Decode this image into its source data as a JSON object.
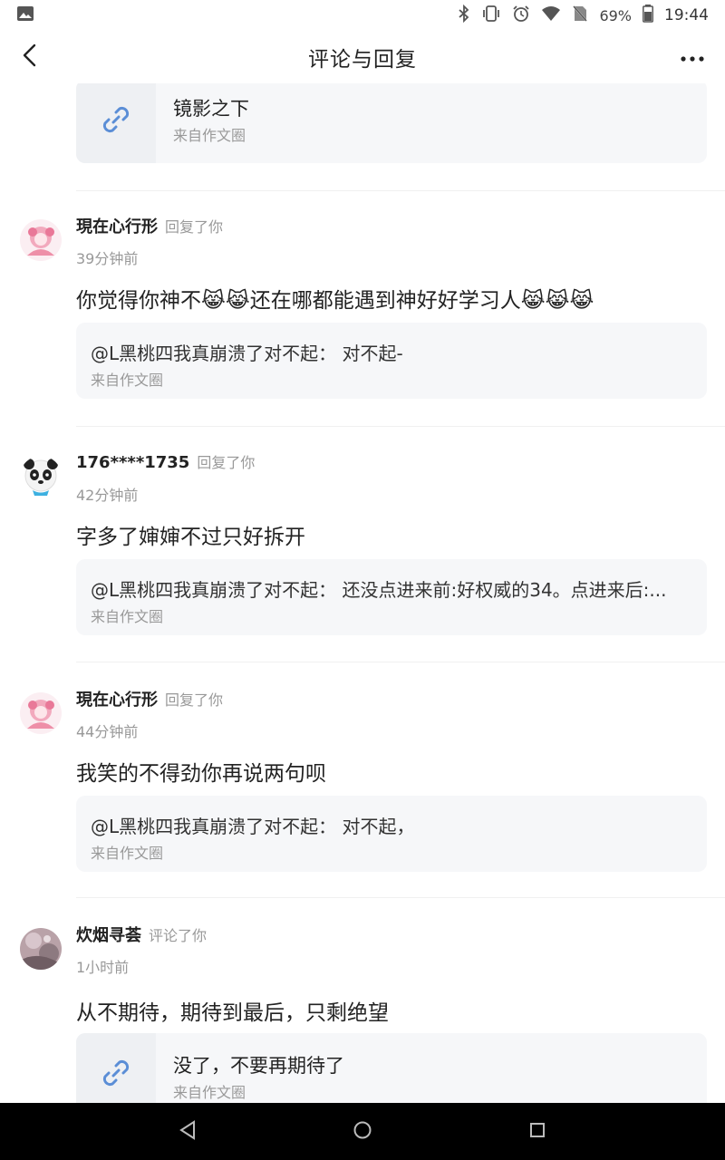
{
  "status_bar": {
    "battery": "69%",
    "time": "19:44",
    "icons": [
      "image-icon",
      "bluetooth-icon",
      "vibrate-icon",
      "alarm-icon",
      "wifi-icon",
      "no-sim-icon",
      "battery-icon"
    ]
  },
  "header": {
    "title": "评论与回复",
    "back_icon": "back-arrow-icon",
    "more_icon": "more-icon"
  },
  "top_card": {
    "title": "镜影之下",
    "source": "来自作文圈",
    "icon": "link-icon"
  },
  "items": [
    {
      "user": "現在心行形",
      "action": "回复了你",
      "time": "39分钟前",
      "message": "你觉得你神不😹😹还在哪都能遇到神好好学习人😹😹😹",
      "quote": "@L黑桃四我真崩溃了对不起： 对不起-",
      "source": "来自作文圈"
    },
    {
      "user": "176****1735",
      "action": "回复了你",
      "time": "42分钟前",
      "message": "字多了婶婶不过只好拆开",
      "quote": "@L黑桃四我真崩溃了对不起： 还没点进来前:好权威的34。点进来后:...",
      "source": "来自作文圈"
    },
    {
      "user": "現在心行形",
      "action": "回复了你",
      "time": "44分钟前",
      "message": "我笑的不得劲你再说两句呗",
      "quote": "@L黑桃四我真崩溃了对不起： 对不起，",
      "source": "来自作文圈"
    },
    {
      "user": "炊烟寻荟",
      "action": "评论了你",
      "time": "1小时前",
      "message": "从不期待，期待到最后，只剩绝望",
      "link_title": "没了，不要再期待了",
      "source": "来自作文圈"
    }
  ],
  "nav_bar": {
    "icons": [
      "nav-back-icon",
      "nav-home-icon",
      "nav-recents-icon"
    ]
  },
  "colors": {
    "card_bg": "#f6f7f9",
    "secondary_text": "#999999",
    "primary_text": "#222222"
  }
}
